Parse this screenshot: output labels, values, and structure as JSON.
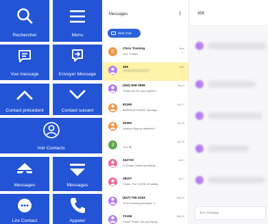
{
  "grid": {
    "search_label": "Rechercher",
    "menu_label": "Menu",
    "view_message_label": "Vue message",
    "send_message_label": "Envoyer Message",
    "prev_contact_label": "Contact précédent",
    "next_contact_label": "Contact suivant",
    "view_contacts_label": "Voir Contacts",
    "messages_up_label": "Messages",
    "messages_down_label": "Messages",
    "read_contact_label": "Lire Contact",
    "call_label": "Appeler",
    "tile_color": "#2454d6"
  },
  "list": {
    "title": "Messages",
    "menu_glyph": "⋮",
    "start_chat_label": "Start chat",
    "conversations": [
      {
        "letter": "C",
        "name": "Chris Training",
        "preview": "You: Thanks",
        "date": "Now",
        "sub": "1",
        "color": "#f0974a"
      },
      {
        "letter": "",
        "name": "456",
        "preview": "",
        "date": "Wed",
        "sub": "",
        "color": "#b57ef0"
      },
      {
        "letter": "",
        "name": "(352) 559-2969",
        "preview": "Thank you for your paymen...",
        "date": "May 4",
        "sub": "",
        "color": "#b57ef0"
      },
      {
        "letter": "",
        "name": "82290",
        "preview": "BARRINGTONIZO: Barringt...",
        "date": "Apr 27",
        "sub": "",
        "color": "#f0974a"
      },
      {
        "letter": "",
        "name": "25392",
        "preview": "Amazon Sign-in detected f...",
        "date": "Apr 25",
        "sub": "",
        "color": "#f0974a"
      },
      {
        "letter": "J",
        "name": "",
        "preview": "You: 😀",
        "date": "Apr 18",
        "sub": "",
        "color": "#5fa84e"
      },
      {
        "letter": "",
        "name": "242733",
        "preview": "Fr.Chase Online Identificat...",
        "date": "Apr 3",
        "sub": "",
        "color": "#ef6d9c"
      },
      {
        "letter": "",
        "name": "28107",
        "preview": "Chase: For COVID-19 safety...",
        "date": "Apr 1",
        "sub": "",
        "color": "#ef6d9c"
      },
      {
        "letter": "",
        "name": "(847) 750-3153",
        "preview": "Hi! It's Working America. Y...",
        "date": "Mar 31",
        "sub": "",
        "color": "#b57ef0"
      },
      {
        "letter": "",
        "name": "72166",
        "preview": "Chase Fraud: Are you trying...",
        "date": "Mar 25",
        "sub": "",
        "color": "#b57ef0"
      }
    ]
  },
  "conversation": {
    "title": "456",
    "input_placeholder": "Text message"
  }
}
